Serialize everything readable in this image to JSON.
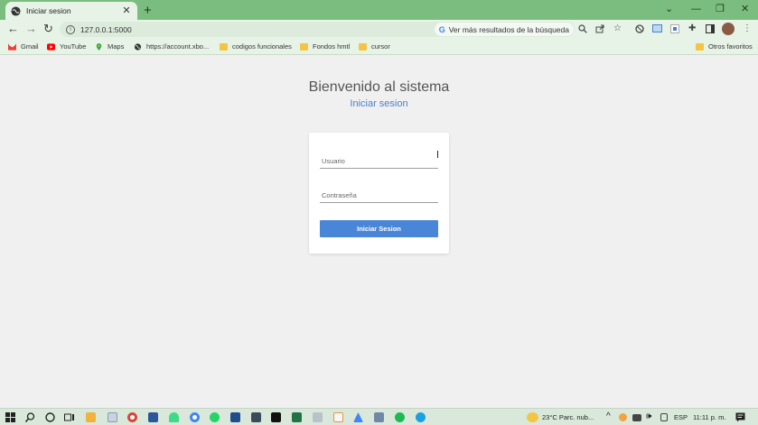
{
  "browser": {
    "tab": {
      "title": "Iniciar sesion",
      "close_icon": "close-icon"
    },
    "new_tab_label": "+",
    "window_controls": {
      "dropdown": "⌄",
      "minimize": "—",
      "restore": "❐",
      "close": "✕"
    },
    "address": {
      "url": "127.0.0.1:5000",
      "search_suggestion": "Ver más resultados de la búsqueda"
    },
    "bookmarks": [
      {
        "label": "Gmail",
        "icon": "gmail-icon",
        "color": "#ea4335"
      },
      {
        "label": "YouTube",
        "icon": "youtube-icon",
        "color": "#ff0000"
      },
      {
        "label": "Maps",
        "icon": "maps-icon",
        "color": "#34a853"
      },
      {
        "label": "https://account.xbo...",
        "icon": "globe-icon",
        "color": "#333333"
      },
      {
        "label": "codigos funcionales",
        "icon": "folder-icon",
        "color": "#f4c542"
      },
      {
        "label": "Fondos hmtl",
        "icon": "folder-icon",
        "color": "#f4c542"
      },
      {
        "label": "cursor",
        "icon": "folder-icon",
        "color": "#f4c542"
      }
    ],
    "other_bookmarks": "Otros favoritos"
  },
  "page": {
    "heading": "Bienvenido al sistema",
    "subheading_link": "Iniciar sesion",
    "form": {
      "username_placeholder": "Usuario",
      "password_placeholder": "Contraseña",
      "submit_label": "Iniciar Sesion"
    }
  },
  "taskbar": {
    "weather": "23°C  Parc. nub...",
    "language": "ESP",
    "time": "11:11 p. m."
  },
  "colors": {
    "chrome_green": "#7bbd7e",
    "accent_blue": "#4a86d8",
    "link_blue": "#4a7fd0"
  }
}
